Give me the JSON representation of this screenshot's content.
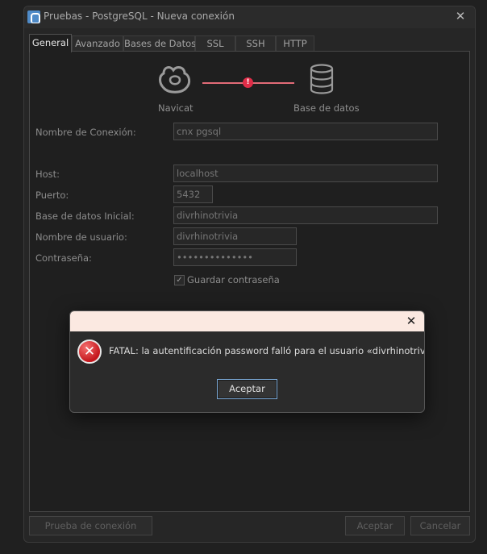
{
  "window": {
    "title": "Pruebas - PostgreSQL - Nueva conexión",
    "close_glyph": "✕"
  },
  "tabs": [
    {
      "label": "General",
      "active": true
    },
    {
      "label": "Avanzado",
      "active": false
    },
    {
      "label": "Bases de Datos",
      "active": false
    },
    {
      "label": "SSL",
      "active": false
    },
    {
      "label": "SSH",
      "active": false
    },
    {
      "label": "HTTP",
      "active": false
    }
  ],
  "diagram": {
    "left_label": "Navicat",
    "right_label": "Base de datos",
    "status_glyph": "!",
    "line_color": "#e26b77",
    "error_color": "#e02d48"
  },
  "form": {
    "connection_name": {
      "label": "Nombre de Conexión:",
      "value": "cnx pgsql"
    },
    "host": {
      "label": "Host:",
      "value": "localhost"
    },
    "port": {
      "label": "Puerto:",
      "value": "5432"
    },
    "initial_db": {
      "label": "Base de datos Inicial:",
      "value": "divrhinotrivia"
    },
    "username": {
      "label": "Nombre de usuario:",
      "value": "divrhinotrivia"
    },
    "password": {
      "label": "Contraseña:",
      "value": "••••••••••••••"
    },
    "save_password": {
      "label": "Guardar contraseña",
      "checked": true,
      "glyph": "✓"
    }
  },
  "footer": {
    "test_label": "Prueba de conexión",
    "ok_label": "Aceptar",
    "cancel_label": "Cancelar"
  },
  "dialog": {
    "message": "FATAL:  la autentificación password falló para el usuario «divrhinotrivia»",
    "ok_label": "Aceptar",
    "close_glyph": "✕",
    "icon_glyph": "✕",
    "title_color": "#fbe9e1"
  },
  "icons": {
    "app": "postgresql-elephant-icon",
    "navicat": "navicat-logo-icon",
    "database": "database-icon",
    "error": "error-icon"
  }
}
